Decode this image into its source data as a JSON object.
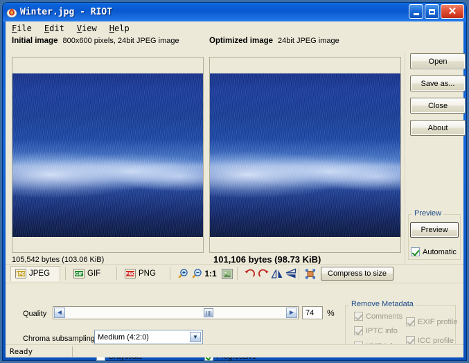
{
  "window": {
    "title": "Winter.jpg - RIOT",
    "icon": "flame-icon",
    "minimize_label": "Minimize",
    "maximize_label": "Maximize",
    "close_label": "Close"
  },
  "menu": {
    "items": [
      {
        "label": "File",
        "accesskey": "F"
      },
      {
        "label": "Edit",
        "accesskey": "E"
      },
      {
        "label": "View",
        "accesskey": "V"
      },
      {
        "label": "Help",
        "accesskey": "H"
      }
    ]
  },
  "panels": {
    "initial": {
      "title": "Initial image",
      "details": "800x600 pixels, 24bit JPEG image",
      "size": "105,542 bytes (103.06 KiB)"
    },
    "optimized": {
      "title": "Optimized image",
      "details": "24bit JPEG image",
      "size": "101,106 bytes (98.73 KiB)"
    }
  },
  "side_buttons": [
    {
      "label": "Open",
      "name": "open-button"
    },
    {
      "label": "Save as...",
      "name": "save-as-button"
    },
    {
      "label": "Close",
      "name": "close-button"
    },
    {
      "label": "About",
      "name": "about-button"
    }
  ],
  "preview": {
    "group_label": "Preview",
    "button_label": "Preview",
    "automatic_label": "Automatic",
    "automatic_checked": true
  },
  "toolbar": {
    "tabs": [
      {
        "label": "JPEG",
        "icon": "jpeg-format-icon",
        "active": true
      },
      {
        "label": "GIF",
        "icon": "gif-format-icon",
        "active": false
      },
      {
        "label": "PNG",
        "icon": "png-format-icon",
        "active": false
      }
    ],
    "zoom_in": "zoom-in-icon",
    "zoom_out": "zoom-out-icon",
    "zoom_actual": "1:1",
    "fit_image": "fit-image-icon",
    "rotate_left": "rotate-left-icon",
    "rotate_right": "rotate-right-icon",
    "flip_horizontal": "flip-horizontal-icon",
    "flip_vertical": "flip-vertical-icon",
    "resize": "resize-image-icon",
    "compress_to_size": "Compress to size"
  },
  "settings": {
    "quality_label": "Quality",
    "quality_value": "74",
    "quality_percent": "%",
    "quality_slider_position_pct": 65,
    "slider_left_arrow": "◄",
    "slider_right_arrow": "►",
    "chroma_label": "Chroma subsampling",
    "chroma_value": "Medium (4:2:0)",
    "grayscale_label": "Grayscale",
    "grayscale_checked": false,
    "progressive_label": "Progressive",
    "progressive_checked": true
  },
  "metadata": {
    "group_label": "Remove Metadata",
    "items": [
      {
        "label": "Comments",
        "checked": true,
        "disabled": true
      },
      {
        "label": "IPTC info",
        "checked": true,
        "disabled": true
      },
      {
        "label": "XMP info",
        "checked": true,
        "disabled": true
      },
      {
        "label": "EXIF profile",
        "checked": true,
        "disabled": true
      },
      {
        "label": "ICC profile",
        "checked": true,
        "disabled": true
      }
    ]
  },
  "statusbar": {
    "text": "Ready"
  },
  "colors": {
    "title_blue": "#0a58cf",
    "client_bg": "#ece9d8",
    "accent": "#1c4a8a",
    "close_red": "#c32e16"
  }
}
